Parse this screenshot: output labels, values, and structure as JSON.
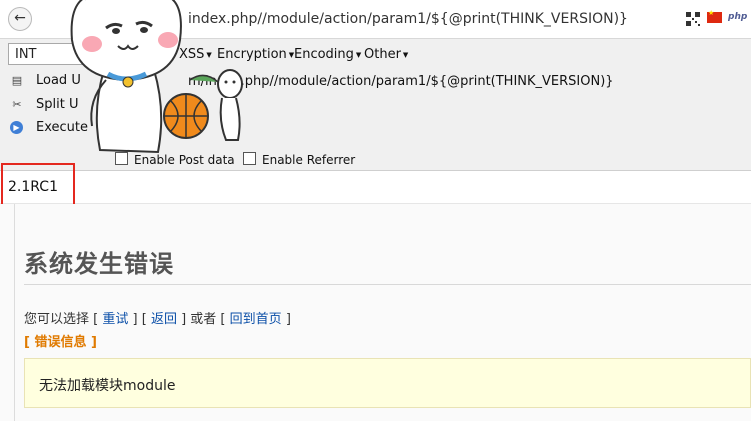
{
  "browser": {
    "back_glyph": "←",
    "url": "index.php//module/action/param1/${@print(THINK_VERSION)}"
  },
  "hackbar": {
    "select_value": "INT",
    "menus": [
      {
        "label": "XSS"
      },
      {
        "label": "Encryption"
      },
      {
        "label": "Encoding"
      },
      {
        "label": "Other"
      }
    ],
    "actions": {
      "load_url": "Load U",
      "split_url": "Split U",
      "execute": "Execute"
    },
    "url_value": "m/index.php//module/action/param1/${@print(THINK_VERSION)}",
    "enable_post": "Enable Post data",
    "enable_referrer": "Enable Referrer"
  },
  "result": {
    "version": "2.1RC1"
  },
  "error_page": {
    "title": "系统发生错误",
    "choose_prefix": "您可以选择 [",
    "retry": "重试",
    "sep1": "] [",
    "back": "返回",
    "sep2": "] 或者 [",
    "home": "回到首页",
    "suffix": "]",
    "error_info": "[ 错误信息 ]",
    "message": "无法加载模块module"
  },
  "colors": {
    "highlight_box": "#e4281f",
    "link": "#0b4fa8",
    "error_info": "#e07a00",
    "message_bg": "#ffffdf"
  }
}
